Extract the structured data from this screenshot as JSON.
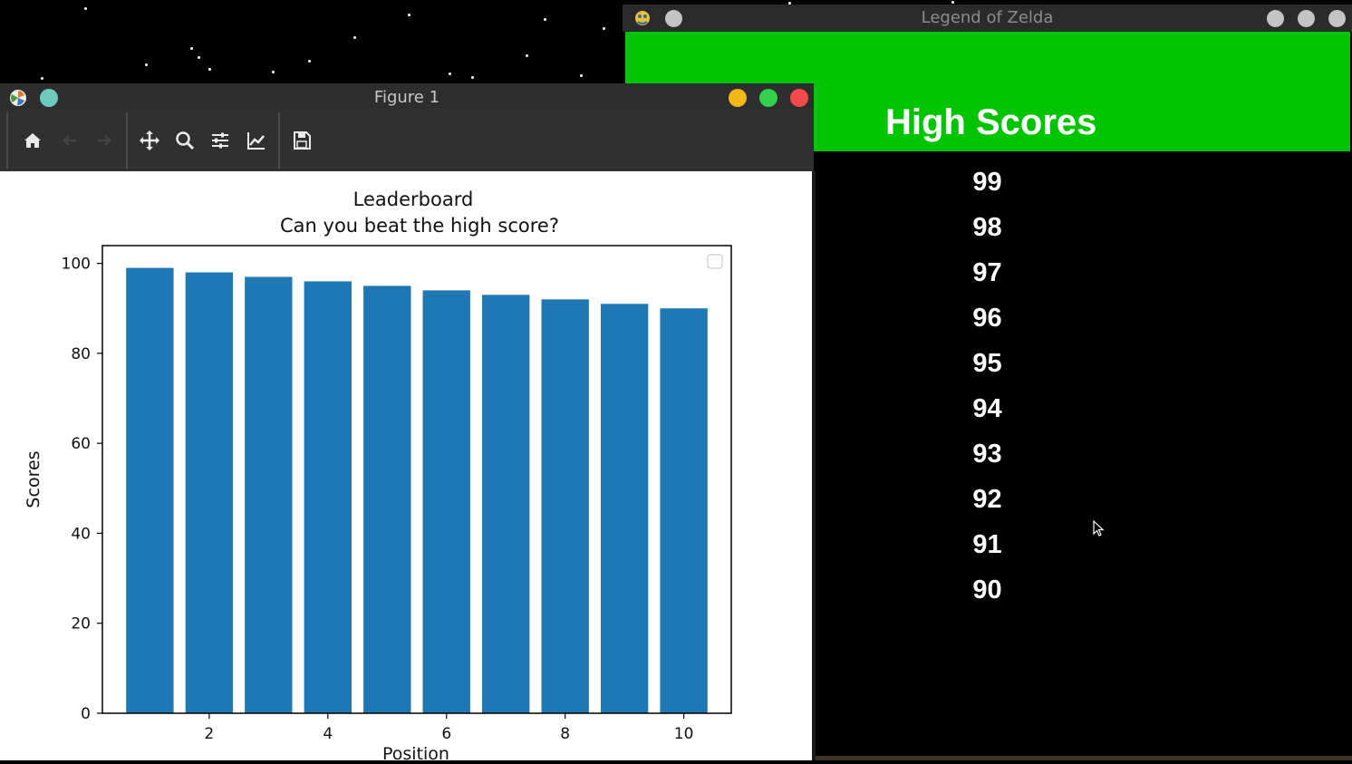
{
  "zelda": {
    "title": "Legend of Zelda",
    "heading": "High Scores",
    "scores": [
      "99",
      "98",
      "97",
      "96",
      "95",
      "94",
      "93",
      "92",
      "91",
      "90"
    ]
  },
  "figure": {
    "title": "Figure 1",
    "toolbar": [
      "home-icon",
      "back-arrow-icon",
      "forward-arrow-icon",
      "pan-icon",
      "zoom-icon",
      "configure-subplots-icon",
      "edit-axes-icon",
      "save-icon"
    ]
  },
  "chart_data": {
    "type": "bar",
    "title": "Leaderboard",
    "subtitle": "Can you beat the high score?",
    "xlabel": "Position",
    "ylabel": "Scores",
    "x": [
      1,
      2,
      3,
      4,
      5,
      6,
      7,
      8,
      9,
      10
    ],
    "values": [
      99,
      98,
      97,
      96,
      95,
      94,
      93,
      92,
      91,
      90
    ],
    "xticks": [
      2,
      4,
      6,
      8,
      10
    ],
    "yticks": [
      0,
      20,
      40,
      60,
      80,
      100
    ],
    "xlim": [
      0.2,
      10.8
    ],
    "ylim": [
      0,
      103.95
    ],
    "color": "#1f77b4",
    "legend": "top-right, empty"
  },
  "colors": {
    "zelda_banner": "#00c400",
    "bar": "#1f77b4",
    "close": "#f24a4a",
    "minimize": "#f2b81a",
    "maximize": "#34cf4d"
  }
}
